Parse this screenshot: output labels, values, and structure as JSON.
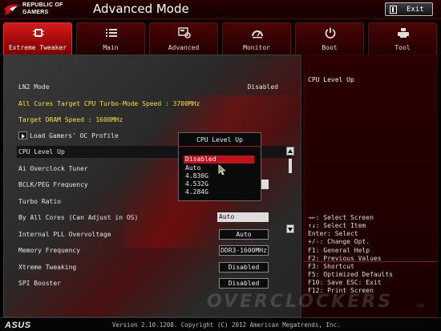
{
  "header": {
    "brand_line1": "REPUBLIC OF",
    "brand_line2": "GAMERS",
    "title": "Advanced Mode",
    "exit_label": "Exit"
  },
  "tabs": [
    {
      "label": "Extreme Tweaker",
      "icon": "cpu-chip-icon",
      "active": true
    },
    {
      "label": "Main",
      "icon": "list-icon",
      "active": false
    },
    {
      "label": "Advanced",
      "icon": "advanced-settings-icon",
      "active": false
    },
    {
      "label": "Monitor",
      "icon": "gauge-icon",
      "active": false
    },
    {
      "label": "Boot",
      "icon": "power-icon",
      "active": false
    },
    {
      "label": "Tool",
      "icon": "printer-tool-icon",
      "active": false
    }
  ],
  "settings": {
    "ln2_mode": {
      "label": "LN2 Mode",
      "value": "Disabled"
    },
    "cpu_turbo_speed": "All Cores Target CPU Turbo-Mode Speed : 3700MHz",
    "dram_speed": "Target DRAM Speed : 1600MHz",
    "load_profile": "Load Gamers' OC Profile",
    "cpu_level_up": {
      "label": "CPU Level Up"
    },
    "ai_overclock": {
      "label": "Ai Overclock Tuner"
    },
    "bclk": {
      "label": "BCLK/PEG Frequency"
    },
    "turbo_ratio": {
      "label": "Turbo Ratio"
    },
    "by_all_cores": {
      "label": "By All Cores (Can Adjust in OS)",
      "value": "Auto"
    },
    "pll_overvoltage": {
      "label": "Internal PLL Overvoltage",
      "value": "Auto"
    },
    "memory_frequency": {
      "label": "Memory Frequency",
      "value": "DDR3-1600MHz"
    },
    "xtreme_tweaking": {
      "label": "Xtreme Tweaking",
      "value": "Disabled"
    },
    "spi_booster": {
      "label": "SPI Booster",
      "value": "Disabled"
    }
  },
  "popup": {
    "title": "CPU Level Up",
    "options": [
      "Disabled",
      "Auto",
      "4.830G",
      "4.532G",
      "4.284G"
    ],
    "selected": "Disabled"
  },
  "help": {
    "title": "CPU Level Up",
    "keys": [
      {
        "text": "→←: Select Screen",
        "highlight": false
      },
      {
        "text": "↑↓: Select Item",
        "highlight": false
      },
      {
        "text": "Enter: Select",
        "highlight": false
      },
      {
        "text": "+/-: Change Opt.",
        "highlight": false
      },
      {
        "text": "F1: General Help",
        "highlight": false
      },
      {
        "text": "F2: Previous Values",
        "highlight": false
      },
      {
        "text": "F3: Shortcut",
        "highlight": true
      },
      {
        "text": "F5: Optimized Defaults",
        "highlight": false
      },
      {
        "text": "F10: Save  ESC: Exit",
        "highlight": false
      },
      {
        "text": "F12: Print Screen",
        "highlight": true
      }
    ]
  },
  "footer": {
    "brand": "ASUS",
    "version": "Version 2.10.1208. Copyright (C) 2012 American Megatrends, Inc."
  },
  "watermark": {
    "text": "OVERCLOCKERS",
    "suffix": "ua"
  },
  "colors": {
    "accent": "#c0141c",
    "highlight_text": "#f0e32a",
    "background": "#000000"
  }
}
